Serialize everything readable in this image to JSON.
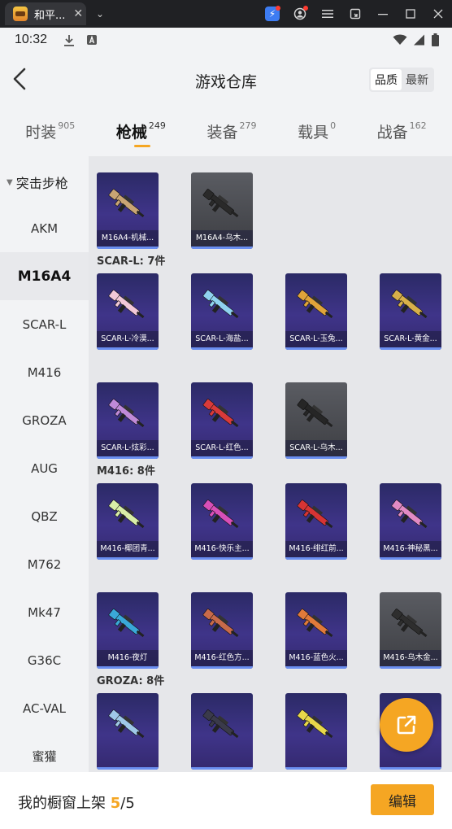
{
  "window": {
    "tab_title": "和平...",
    "tab_close": "✕",
    "chevron": "⌄",
    "controls": [
      "bolt-icon",
      "profile-icon",
      "menu-icon",
      "screenshot-icon",
      "minimize-icon",
      "maximize-icon",
      "close-icon"
    ]
  },
  "status_bar": {
    "time": "10:32",
    "icons": [
      "download-icon",
      "font-icon",
      "wifi-icon",
      "signal-icon",
      "battery-icon"
    ]
  },
  "header": {
    "title": "游戏仓库",
    "sort_options": [
      "品质",
      "最新"
    ],
    "sort_active": "品质"
  },
  "tabs": [
    {
      "label": "时装",
      "count": "905",
      "active": false
    },
    {
      "label": "枪械",
      "count": "249",
      "active": true
    },
    {
      "label": "装备",
      "count": "279",
      "active": false
    },
    {
      "label": "载具",
      "count": "0",
      "active": false
    },
    {
      "label": "战备",
      "count": "162",
      "active": false
    }
  ],
  "sidebar": {
    "category": "突击步枪",
    "items": [
      {
        "label": "AKM",
        "active": false
      },
      {
        "label": "M16A4",
        "active": true
      },
      {
        "label": "SCAR-L",
        "active": false
      },
      {
        "label": "M416",
        "active": false
      },
      {
        "label": "GROZA",
        "active": false
      },
      {
        "label": "AUG",
        "active": false
      },
      {
        "label": "QBZ",
        "active": false
      },
      {
        "label": "M762",
        "active": false
      },
      {
        "label": "Mk47",
        "active": false
      },
      {
        "label": "G36C",
        "active": false
      },
      {
        "label": "AC-VAL",
        "active": false
      },
      {
        "label": "蜜獾",
        "active": false
      }
    ]
  },
  "sections": [
    {
      "label": "",
      "items": [
        {
          "name": "M16A4-机械...",
          "style": "purple",
          "color": "#c9a574"
        },
        {
          "name": "M16A4-乌木...",
          "style": "gray",
          "color": "#2a2a2a"
        }
      ]
    },
    {
      "label": "SCAR-L: 7件",
      "items": [
        {
          "name": "SCAR-L-冷漠...",
          "style": "purple",
          "color": "#f2c9d8"
        },
        {
          "name": "SCAR-L-海盐...",
          "style": "purple",
          "color": "#8fd3f0"
        },
        {
          "name": "SCAR-L-玉兔...",
          "style": "purple",
          "color": "#e0a43a"
        },
        {
          "name": "SCAR-L-黄金...",
          "style": "purple",
          "color": "#d8b04a"
        },
        {
          "name": "SCAR-L-炫彩...",
          "style": "purple",
          "color": "#c08ad8"
        },
        {
          "name": "SCAR-L-红色...",
          "style": "purple",
          "color": "#d83a3a"
        },
        {
          "name": "SCAR-L-乌木...",
          "style": "gray",
          "color": "#262626"
        }
      ]
    },
    {
      "label": "M416: 8件",
      "items": [
        {
          "name": "M416-椰团青...",
          "style": "purple",
          "color": "#d9eea8"
        },
        {
          "name": "M416-快乐主...",
          "style": "purple",
          "color": "#d84fb8"
        },
        {
          "name": "M416-绯红前...",
          "style": "purple",
          "color": "#d63434"
        },
        {
          "name": "M416-神秘黑...",
          "style": "purple",
          "color": "#e28ac4"
        },
        {
          "name": "M416-夜灯",
          "style": "purple",
          "color": "#3aa8d8"
        },
        {
          "name": "M416-红色方...",
          "style": "purple",
          "color": "#c86a4a"
        },
        {
          "name": "M416-蓝色火...",
          "style": "purple",
          "color": "#e07a3a"
        },
        {
          "name": "M416-乌木金...",
          "style": "gray",
          "color": "#2e2e2e"
        }
      ]
    },
    {
      "label": "GROZA: 8件",
      "items": [
        {
          "name": "",
          "style": "purple",
          "color": "#9fc8e8"
        },
        {
          "name": "",
          "style": "purple",
          "color": "#3a3a4a"
        },
        {
          "name": "",
          "style": "purple",
          "color": "#e8d84a"
        },
        {
          "name": "",
          "style": "purple",
          "color": "#4ad8e0"
        }
      ]
    }
  ],
  "fab": {
    "icon": "share-external-icon",
    "color": "#f5a623"
  },
  "bottom": {
    "prefix": "我的橱窗上架 ",
    "count": "5",
    "total": "/5",
    "edit_label": "编辑"
  },
  "colors": {
    "accent": "#f5a623",
    "card_purple": "#3f3489",
    "card_gray": "#4a4b50"
  }
}
